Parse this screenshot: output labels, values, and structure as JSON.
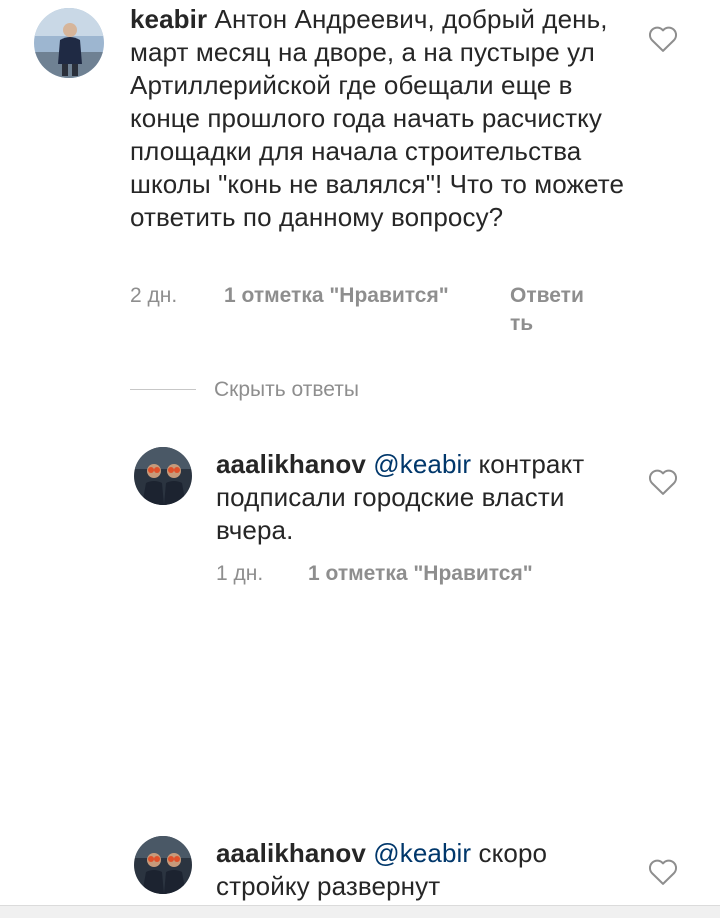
{
  "comments": [
    {
      "username": "keabir",
      "text": " Антон Андреевич, добрый день, март месяц на дворе, а на пустыре ул Артиллерийской где обещали еще в конце прошлого года начать расчистку площадки для начала строительства школы \"конь не валялся\"! Что то можете ответить по данному вопросу?",
      "time": "2 дн.",
      "likes": "1 отметка \"Нравится\"",
      "reply": "Ответить",
      "reply_line1": "Ответи",
      "reply_line2": "ть",
      "avatar_icon": "user-avatar-photo",
      "like_icon": "heart-outline-icon"
    }
  ],
  "hide_replies_label": "Скрыть ответы",
  "replies": [
    {
      "username": "aaalikhanov",
      "mention": "@keabir",
      "text": " контракт подписали городские власти вчера.",
      "time": "1 дн.",
      "likes": "1 отметка \"Нравится\"",
      "like_icon": "heart-outline-icon"
    },
    {
      "username": "aaalikhanov",
      "mention": "@keabir",
      "text": " скоро стройку развернут",
      "like_icon": "heart-outline-icon"
    }
  ],
  "colors": {
    "text": "#262626",
    "secondary": "#8e8e8e",
    "mention": "#00376b",
    "divider": "#c7c7c7"
  }
}
